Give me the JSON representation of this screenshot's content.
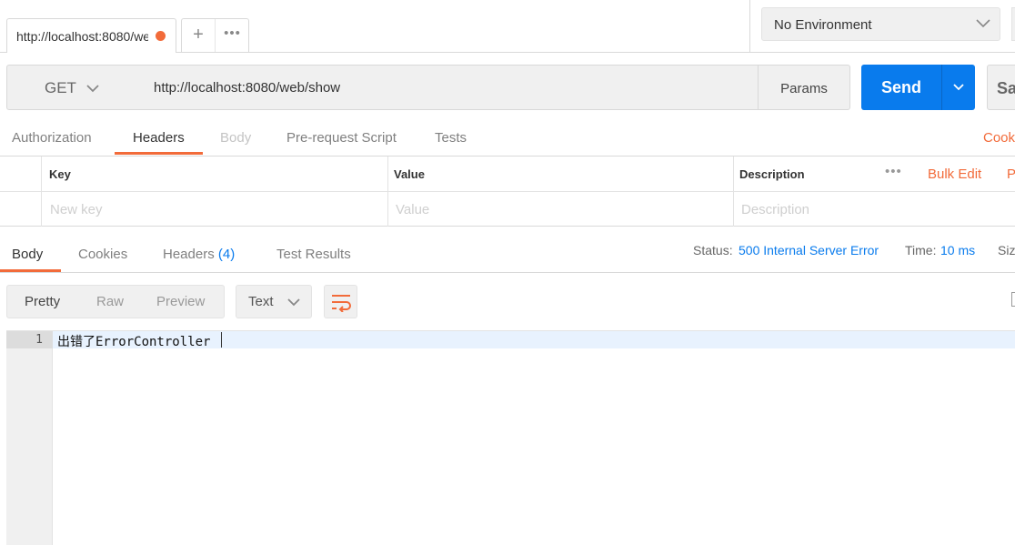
{
  "request_tab": {
    "title": "http://localhost:8080/web/show",
    "add_label": "+",
    "more_label": "•••"
  },
  "environment": {
    "selected": "No Environment"
  },
  "request": {
    "method": "GET",
    "url": "http://localhost:8080/web/show",
    "params_label": "Params",
    "send_label": "Send",
    "save_label": "Sa"
  },
  "request_tabs": [
    "Authorization",
    "Headers",
    "Body",
    "Pre-request Script",
    "Tests"
  ],
  "cookies_label": "Cook",
  "headers_table": {
    "columns": [
      "Key",
      "Value",
      "Description"
    ],
    "more_label": "•••",
    "bulk_edit_label": "Bulk Edit",
    "presets_label": "P",
    "placeholders": {
      "key": "New key",
      "value": "Value",
      "description": "Description"
    }
  },
  "response_tabs": {
    "body": "Body",
    "cookies": "Cookies",
    "headers": "Headers",
    "headers_count": "(4)",
    "test_results": "Test Results"
  },
  "response_meta": {
    "status_label": "Status:",
    "status_value": "500 Internal Server Error",
    "time_label": "Time:",
    "time_value": "10 ms",
    "size_label": "Siz"
  },
  "response_view": {
    "modes": [
      "Pretty",
      "Raw",
      "Preview"
    ],
    "format": "Text"
  },
  "response_body": {
    "line_number": "1",
    "line_text": "出错了ErrorController"
  },
  "colors": {
    "accent": "#f26b3a",
    "send": "#097bed",
    "link": "#097bed"
  }
}
